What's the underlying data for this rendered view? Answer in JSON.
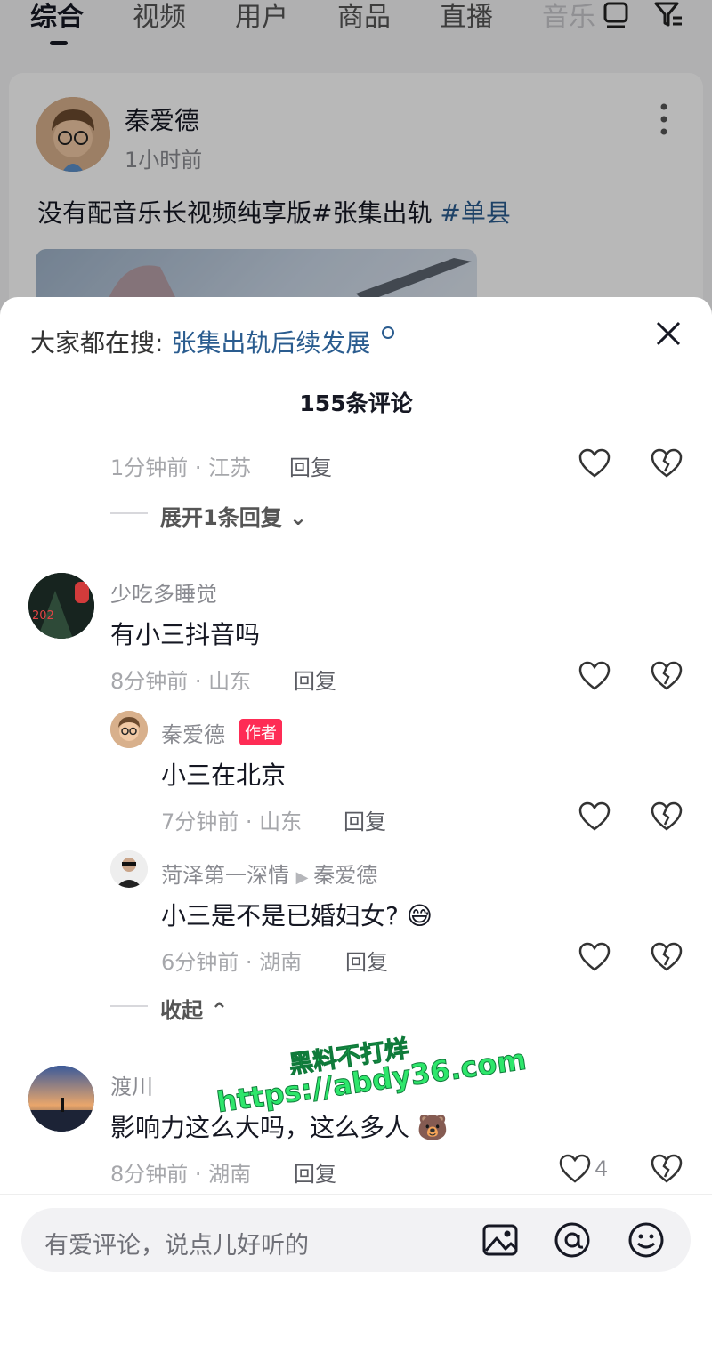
{
  "tabs": [
    "综合",
    "视频",
    "用户",
    "商品",
    "直播",
    "音乐"
  ],
  "post": {
    "author": "秦爱德",
    "time": "1小时前",
    "text": "没有配音乐长视频纯享版#张集出轨",
    "tag": "#单县"
  },
  "sheet": {
    "search_label": "大家都在搜:",
    "search_query": "张集出轨后续发展",
    "comment_count": "155条评论",
    "reply_label": "回复"
  },
  "comments": [
    {
      "meta": "1分钟前 · 江苏",
      "expand": "展开1条回复"
    },
    {
      "user": "少吃多睡觉",
      "text": "有小三抖音吗",
      "meta": "8分钟前 · 山东",
      "replies": [
        {
          "user": "秦爱德",
          "badge": "作者",
          "text": "小三在北京",
          "meta": "7分钟前 · 山东"
        },
        {
          "user": "菏泽第一深情",
          "reply_to": "秦爱德",
          "text": "小三是不是已婚妇女?",
          "emoji": "😅",
          "meta": "6分钟前 · 湖南"
        }
      ],
      "collapse": "收起"
    },
    {
      "user": "渡川",
      "text": "影响力这么大吗，这么多人",
      "emoji": "🐻",
      "meta": "8分钟前 · 湖南",
      "likes": "4"
    }
  ],
  "watermark": {
    "line1": "黑料不打烊",
    "line2": "https://abdy36.com"
  },
  "input": {
    "placeholder": "有爱评论，说点儿好听的"
  },
  "colors": {
    "accent_link": "#2a5c8f",
    "author_badge": "#fe2c55",
    "watermark": "#2ee66b"
  }
}
